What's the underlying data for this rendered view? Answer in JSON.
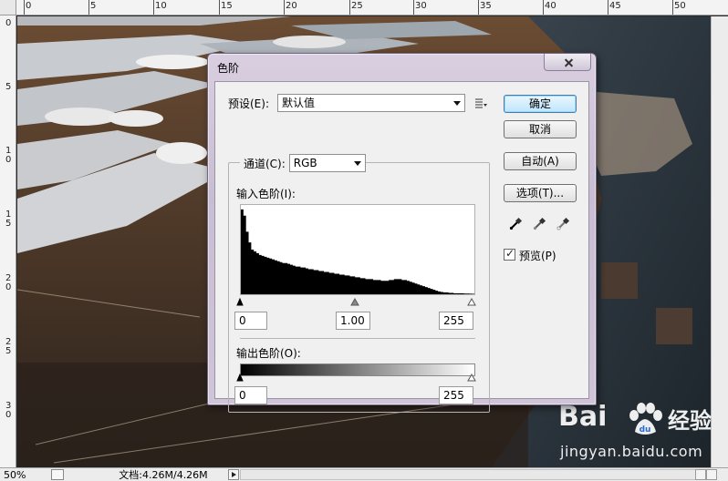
{
  "ruler": {
    "top_labels": [
      "0",
      "5",
      "10",
      "15",
      "20",
      "25",
      "30",
      "35",
      "40",
      "45",
      "50"
    ],
    "left_labels": [
      "0",
      "5",
      "1\n0",
      "1\n5",
      "2\n0",
      "2\n5",
      "3\n0"
    ]
  },
  "dialog": {
    "title": "色阶",
    "preset_label": "预设(E):",
    "preset_value": "默认值",
    "channel_label": "通道(C):",
    "channel_value": "RGB",
    "input_levels_label": "输入色阶(I):",
    "input_black": "0",
    "input_gamma": "1.00",
    "input_white": "255",
    "output_levels_label": "输出色阶(O):",
    "output_black": "0",
    "output_white": "255",
    "buttons": {
      "ok": "确定",
      "cancel": "取消",
      "auto": "自动(A)",
      "options": "选项(T)..."
    },
    "preview_label": "预览(P)",
    "preview_checked": true
  },
  "histogram": {
    "bins": [
      95,
      88,
      70,
      58,
      50,
      48,
      46,
      44,
      43,
      42,
      41,
      40,
      39,
      38,
      37,
      36,
      35,
      35,
      34,
      33,
      32,
      31,
      31,
      30,
      30,
      29,
      28,
      28,
      27,
      27,
      26,
      26,
      25,
      25,
      24,
      24,
      23,
      23,
      22,
      22,
      21,
      21,
      20,
      20,
      19,
      19,
      18,
      18,
      17,
      17,
      17,
      16,
      16,
      16,
      15,
      15,
      15,
      16,
      16,
      17,
      17,
      17,
      16,
      16,
      15,
      14,
      13,
      12,
      11,
      10,
      9,
      8,
      7,
      6,
      5,
      4,
      3,
      2.5,
      2,
      2,
      1.5,
      1.5,
      1,
      1,
      1,
      1,
      0.8,
      0.8,
      0.6,
      0.5
    ]
  },
  "statusbar": {
    "zoom": "50%",
    "docinfo": "文档:4.26M/4.26M"
  },
  "watermark": {
    "logo": "Bai",
    "logo_suffix": "经验",
    "url": "jingyan.baidu.com"
  }
}
